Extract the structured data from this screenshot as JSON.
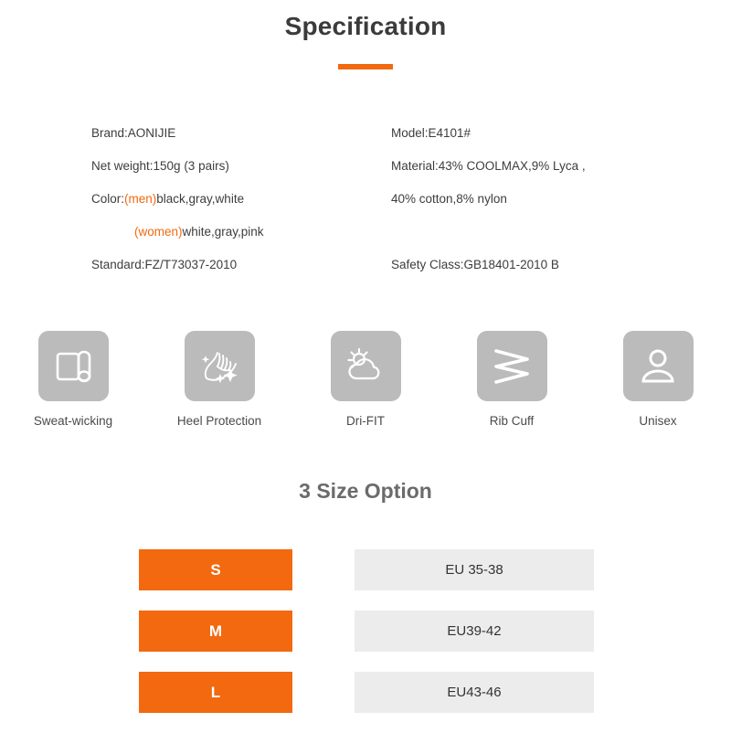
{
  "header": {
    "title": "Specification",
    "accent_color": "#f2690f"
  },
  "spec": {
    "left": [
      {
        "text": "Brand:AONIJIE"
      },
      {
        "text": "Net weight:150g (3 pairs)"
      },
      {
        "prefix": "Color:",
        "accent": "(men)",
        "suffix": "black,gray,white"
      },
      {
        "indent": true,
        "accent": "(women)",
        "suffix": "white,gray,pink"
      },
      {
        "text": "Standard:FZ/T73037-2010"
      }
    ],
    "right": [
      {
        "text": "Model:E4101#"
      },
      {
        "text": "Material:43% COOLMAX,9% Lyca ,"
      },
      {
        "text": "40% cotton,8% nylon"
      },
      {
        "text": "",
        "spacer": true
      },
      {
        "text": "Safety Class:GB18401-2010 B"
      }
    ]
  },
  "features": [
    {
      "icon": "fabric-roll-icon",
      "label": "Sweat-wicking"
    },
    {
      "icon": "foot-sparkle-icon",
      "label": "Heel Protection"
    },
    {
      "icon": "sun-cloud-icon",
      "label": "Dri-FIT"
    },
    {
      "icon": "zigzag-icon",
      "label": "Rib Cuff"
    },
    {
      "icon": "person-icon",
      "label": "Unisex"
    }
  ],
  "sizes": {
    "title": "3 Size Option",
    "rows": [
      {
        "size": "S",
        "eu": "EU 35-38"
      },
      {
        "size": "M",
        "eu": "EU39-42"
      },
      {
        "size": "L",
        "eu": "EU43-46"
      }
    ]
  },
  "colors": {
    "orange": "#f2690f",
    "tile_gray": "#bbbbbb",
    "value_gray": "#ececec",
    "title_gray": "#3b3b3b"
  }
}
